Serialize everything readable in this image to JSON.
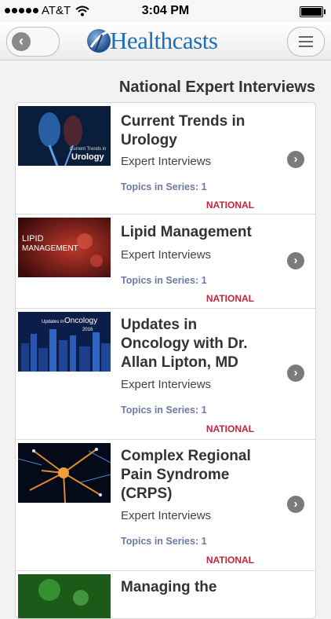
{
  "status_bar": {
    "carrier": "AT&T",
    "time": "3:04 PM"
  },
  "header": {
    "logo_text": "Healthcasts"
  },
  "page_title": "National Expert Interviews",
  "items": [
    {
      "title": "Current Trends in Urology",
      "subtitle": "Expert Interviews",
      "topics": "Topics in Series: 1",
      "badge": "NATIONAL",
      "thumb_text_small": "Current Trends in",
      "thumb_text_big": "Urology"
    },
    {
      "title": "Lipid Management",
      "subtitle": "Expert Interviews",
      "topics": "Topics in Series: 1",
      "badge": "NATIONAL",
      "thumb_text_small": "LIPID",
      "thumb_text_big": "MANAGEMENT"
    },
    {
      "title": "Updates in Oncology with Dr. Allan Lipton, MD",
      "subtitle": "Expert Interviews",
      "topics": "Topics in Series: 1",
      "badge": "NATIONAL",
      "thumb_text_small": "Updates in",
      "thumb_text_big": "Oncology",
      "thumb_text_year": "2016"
    },
    {
      "title": "Complex Regional Pain Syndrome (CRPS)",
      "subtitle": "Expert Interviews",
      "topics": "Topics in Series: 1",
      "badge": "NATIONAL"
    },
    {
      "title": "Managing the"
    }
  ]
}
